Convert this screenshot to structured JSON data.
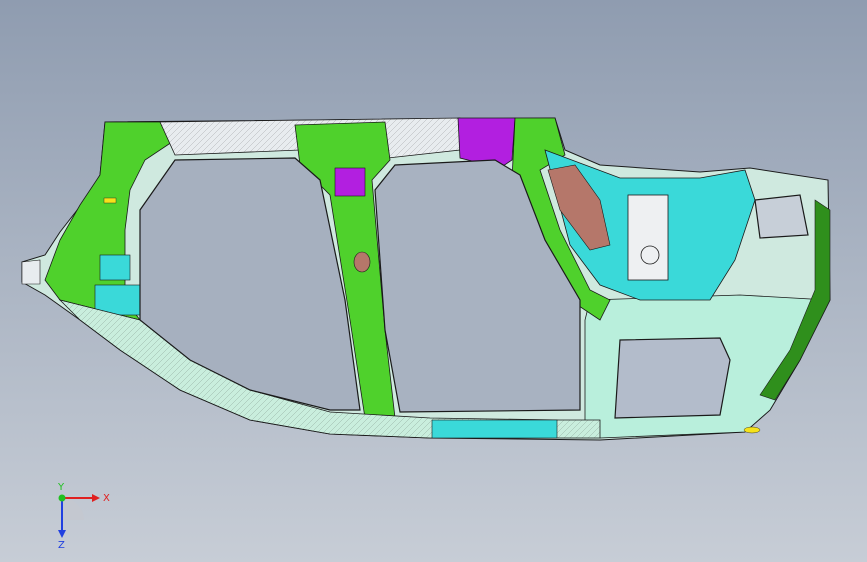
{
  "viewport": {
    "background_top": "#8f9cb0",
    "background_bottom": "#c7cdd6"
  },
  "model": {
    "name": "car-body-side-panel",
    "colors": {
      "green": "#4fd12c",
      "green_dark": "#2f8f1c",
      "magenta": "#b21fe0",
      "cyan": "#3ad9d9",
      "mint": "#b9efdc",
      "white_rail": "#e8ecef",
      "brown": "#b5776a",
      "outline": "#1a1a1a"
    }
  },
  "triad": {
    "x_label": "X",
    "y_label": "Y",
    "z_label": "Z",
    "x_color": "#e02020",
    "y_color": "#20c020",
    "z_color": "#2040e0"
  }
}
